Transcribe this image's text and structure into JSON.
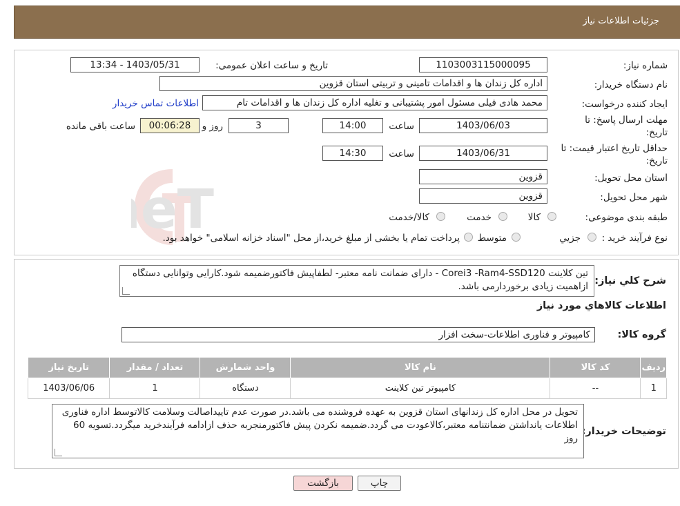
{
  "header": {
    "title": "جزئیات اطلاعات نیاز"
  },
  "form": {
    "need_number_label": "شماره نیاز:",
    "need_number": "1103003115000095",
    "announce_label": "تاریخ و ساعت اعلان عمومی:",
    "announce_value": "1403/05/31 - 13:34",
    "buyer_label": "نام دستگاه خریدار:",
    "buyer_value": "اداره کل زندان ها و اقدامات تامینی و تربیتی استان قزوین",
    "creator_label": "ایجاد کننده درخواست:",
    "creator_value": "محمد هادی فیلی مسئول امور پشتیبانی و تغلیه اداره کل زندان ها و اقدامات تام",
    "contact_link": "اطلاعات تماس خریدار",
    "deadline_label_1": "مهلت ارسال پاسخ: تا",
    "deadline_label_2": "تاریخ:",
    "deadline_date": "1403/06/03",
    "time_label": "ساعت",
    "deadline_time": "14:00",
    "days_value": "3",
    "days_label": "روز و",
    "remaining_value": "00:06:28",
    "remaining_label": "ساعت باقی مانده",
    "validity_label_1": "حداقل تاریخ اعتبار قیمت: تا",
    "validity_label_2": "تاریخ:",
    "validity_date": "1403/06/31",
    "validity_time": "14:30",
    "province_label": "استان محل تحویل:",
    "province_value": "قزوین",
    "city_label": "شهر محل تحویل:",
    "city_value": "قزوین",
    "category_label": "طبقه بندی موضوعی:",
    "category_options": [
      "کالا",
      "خدمت",
      "کالا/خدمت"
    ],
    "process_label": "نوع فرآیند خرید :",
    "process_options": [
      "جزیي",
      "متوسط"
    ],
    "process_note": "پرداخت تمام یا بخشی از مبلغ خرید،از محل \"اسناد خزانه اسلامی\" خواهد بود."
  },
  "details": {
    "summary_label": "شرح کلي نياز:",
    "summary_text": "تین کلاینت Corei3 -Ram4-SSD120 - دارای ضمانت نامه معتبر- لطفاپیش فاکتورضمیمه شود.کارایی وتوانایی دستگاه ازاهمیت زیادی برخوردارمی باشد.",
    "goods_info_title": "اطلاعات کالاهاي مورد نياز",
    "group_label": "گروه کالا:",
    "group_value": "کامپیوتر و فناوری اطلاعات-سخت افزار",
    "table": {
      "headers": [
        "ردیف",
        "کد کالا",
        "نام کالا",
        "واحد شمارش",
        "تعداد / مقدار",
        "تاریخ نیاز"
      ],
      "rows": [
        [
          "1",
          "--",
          "کامپیوتر تین کلاینت",
          "دستگاه",
          "1",
          "1403/06/06"
        ]
      ]
    },
    "buyer_notes_label": "توضیحات خریدار:",
    "buyer_notes_text": "تحویل در محل اداره کل زندانهای استان قزوین به عهده فروشنده می باشد.در صورت عدم تاییداصالت وسلامت کالاتوسط اداره فناوری اطلاعات یانداشتن ضمانتنامه معتبر،کالاعودت می گردد.ضمیمه نکردن پیش فاکتورمنجربه حذف ازادامه فرآیندخرید میگردد.تسویه 60 روز"
  },
  "buttons": {
    "print": "چاپ",
    "back": "بازگشت"
  },
  "watermark_text": "AriaTender.neT",
  "colors": {
    "header_bg": "#8b6f4e",
    "link": "#1f3cc8",
    "timer_bg": "#f7f2cf",
    "table_header": "#b4b4b4",
    "back_button_bg": "#f6d6d6"
  }
}
